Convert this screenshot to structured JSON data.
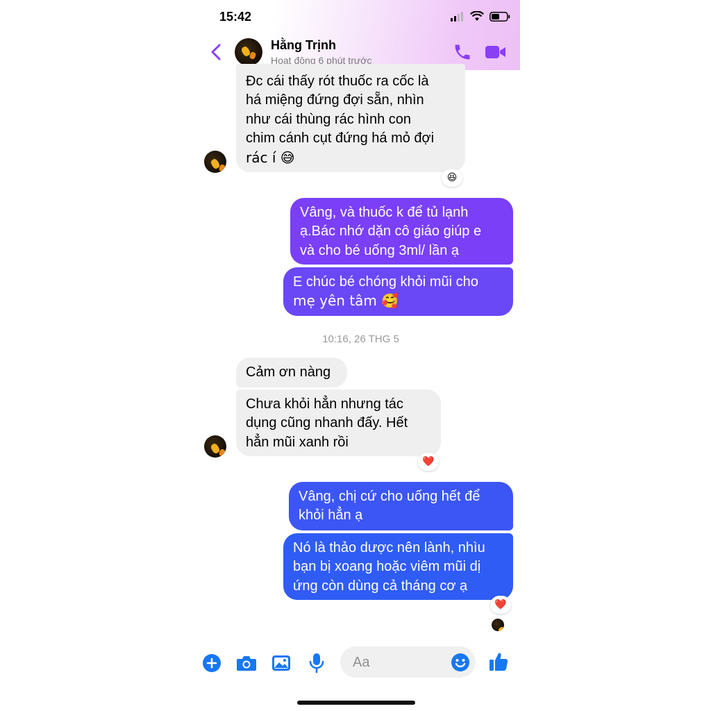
{
  "status_bar": {
    "time": "15:42"
  },
  "header": {
    "contact_name": "Hằng Trịnh",
    "active_status": "Hoạt động 6 phút trước"
  },
  "messages": [
    {
      "id": "m1",
      "from": "them",
      "text": "Đc cái thấy rót thuốc ra cốc là há miệng đứng đợi sẵn, nhìn như cái thùng rác hình con chim cánh cụt đứng há mỏ đợi rác í 😅",
      "lines": [
        "Đc cái thấy rót thuốc ra cốc là",
        "há miệng đứng đợi sẵn, nhìn",
        "như cái thùng rác hình con",
        "chim cánh cụt đứng há mỏ đợi",
        "rác í 😅"
      ],
      "reaction": "😆"
    },
    {
      "id": "m2",
      "from": "me",
      "lines": [
        "Vâng, và thuốc k để tủ lạnh",
        "ạ.Bác nhớ dặn cô giáo giúp e",
        "và cho bé uống 3ml/ lần ạ"
      ]
    },
    {
      "id": "m3",
      "from": "me",
      "lines": [
        "E chúc bé chóng khỏi mũi cho",
        "mẹ yên tâm 🥰"
      ]
    },
    {
      "id": "m4",
      "from": "them",
      "lines": [
        "Cảm ơn nàng"
      ]
    },
    {
      "id": "m5",
      "from": "them",
      "lines": [
        "Chưa khỏi hẳn nhưng tác",
        "dụng cũng nhanh đấy. Hết",
        "hẳn mũi xanh rồi"
      ],
      "reaction": "❤️"
    },
    {
      "id": "m6",
      "from": "me",
      "lines": [
        "Vâng, chị cứ cho uống hết để",
        "khỏi hẳn ạ"
      ]
    },
    {
      "id": "m7",
      "from": "me",
      "lines": [
        "Nó là thảo dược nên lành, nhìu",
        "bạn bị xoang hoặc viêm mũi dị",
        "ứng còn dùng cả tháng cơ ạ"
      ],
      "reaction": "❤️"
    }
  ],
  "timestamp_divider": "10:16, 26 THG 5",
  "composer": {
    "placeholder": "Aa"
  },
  "icons": {
    "back": "chevron-left-icon",
    "call": "phone-icon",
    "video": "video-camera-icon",
    "add": "plus-circle-icon",
    "camera": "camera-icon",
    "gallery": "image-icon",
    "mic": "microphone-icon",
    "emoji": "smiley-icon",
    "like": "thumbs-up-icon"
  },
  "colors": {
    "accent_purple": "#8a3ff5",
    "bubble_purple": "#7a3ff6",
    "bubble_blue": "#2f5cf5",
    "composer_blue": "#1877f2",
    "incoming_bubble": "#efefef"
  }
}
